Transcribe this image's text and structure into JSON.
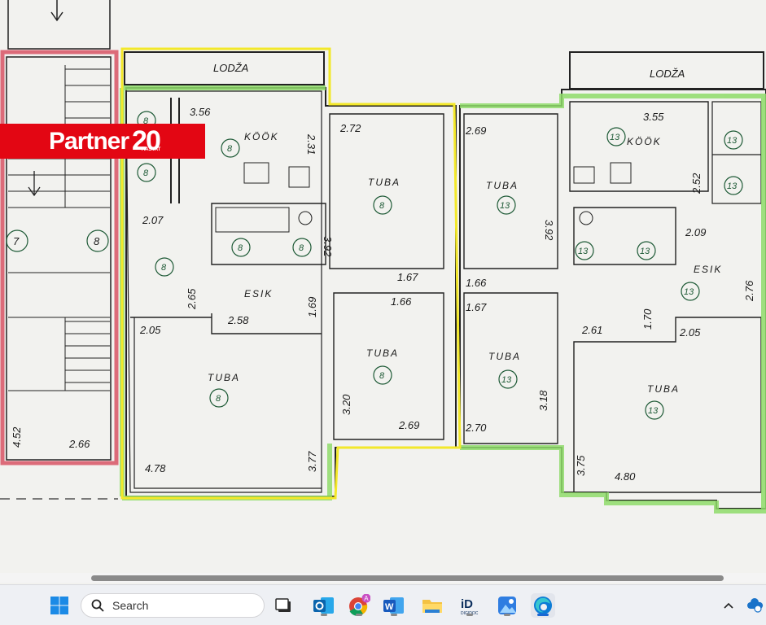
{
  "floorplan": {
    "loggia_labels": [
      "LODŽA",
      "LODŽA"
    ],
    "room_labels": {
      "kook": "KÖÖK",
      "tuba": "TUBA",
      "esik": "ESIK"
    },
    "dimensions": [
      "3.56",
      "2.31",
      "2.72",
      "3.92",
      "1.67",
      "1.66",
      "2.07",
      "2.65",
      "1.69",
      "2.58",
      "2.05",
      "3.20",
      "2.69",
      "3.77",
      "4.78",
      "2.66",
      "4.52",
      "2.69",
      "3.92",
      "1.66",
      "1.67",
      "3.18",
      "2.70",
      "3.55",
      "2.52",
      "2.09",
      "2.76",
      "1.70",
      "2.61",
      "2.05",
      "3.75",
      "4.80"
    ],
    "stair_units": [
      "7",
      "8"
    ],
    "unit_numbers": {
      "left": "8",
      "right": "13"
    }
  },
  "logo": {
    "brand": "Partner",
    "number": "20",
    "tag": "AASTAT"
  },
  "taskbar": {
    "search_placeholder": "Search",
    "apps": [
      "start",
      "task-view",
      "outlook",
      "chrome",
      "word",
      "file-explorer",
      "digidoc",
      "photos",
      "edge"
    ],
    "chrome_badge": "A",
    "digidoc_label": "iD",
    "digidoc_sub": "DIGIDOC"
  },
  "colors": {
    "yellow_outline": "#f3e82a",
    "green_highlight": "#8fdc6a",
    "red_highlight": "#d43d52",
    "logo_red": "#e30613"
  }
}
